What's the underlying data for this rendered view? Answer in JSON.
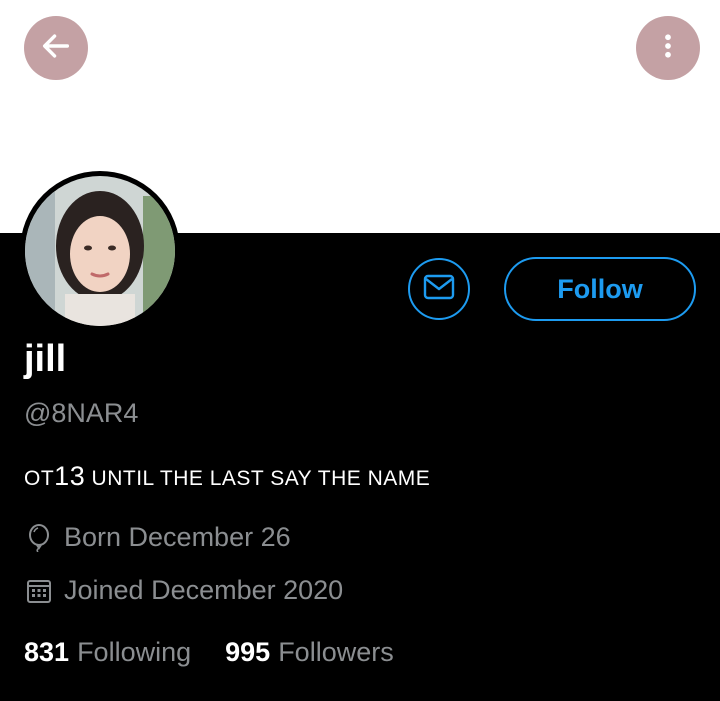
{
  "header": {
    "back_icon": "arrow-left-icon",
    "more_icon": "more-vertical-icon"
  },
  "profile": {
    "display_name": "jill",
    "handle": "@8NAR4",
    "bio_prefix": "OT",
    "bio_number": "13",
    "bio_rest": " UNTIL THE LAST SAY THE NAME",
    "born": "Born December 26",
    "joined": "Joined December 2020"
  },
  "actions": {
    "message_icon": "envelope-icon",
    "follow_label": "Follow"
  },
  "stats": {
    "following_count": "831",
    "following_label": "Following",
    "followers_count": "995",
    "followers_label": "Followers"
  },
  "colors": {
    "accent": "#1d9bf0",
    "header_button": "#c4a1a4",
    "muted_text": "#8b8e91"
  }
}
